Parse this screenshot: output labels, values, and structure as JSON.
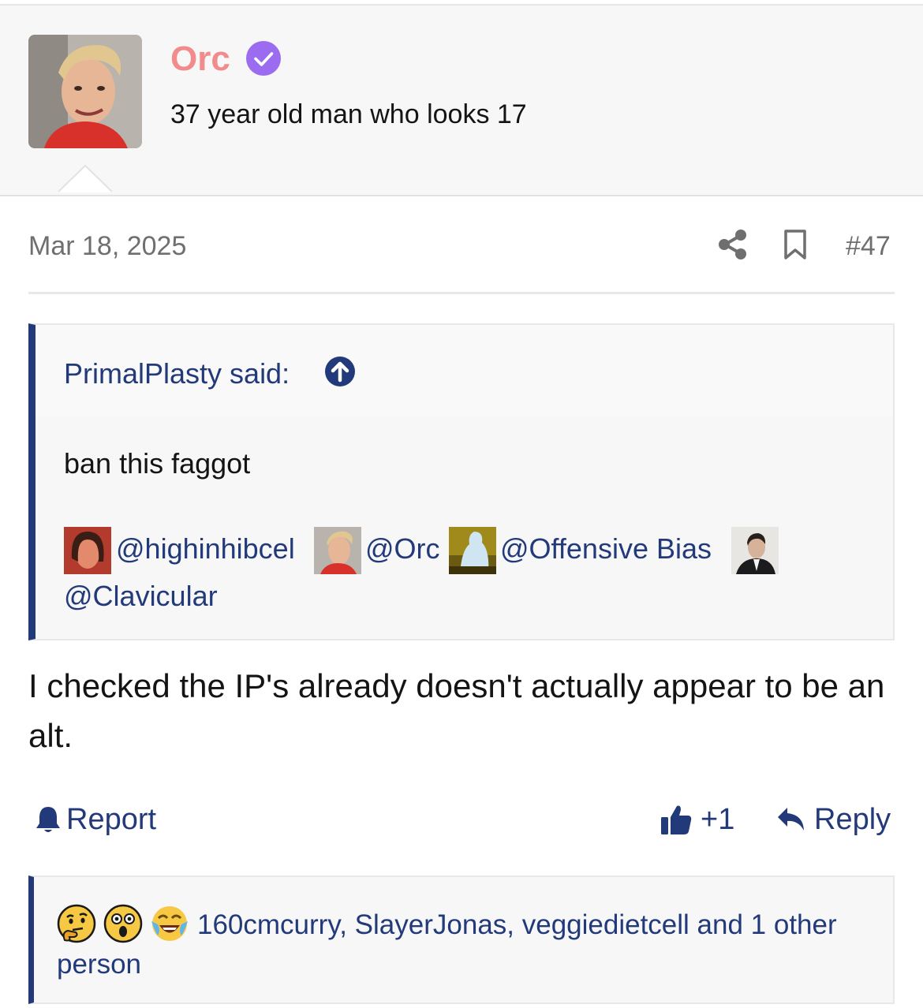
{
  "author": {
    "name": "Orc",
    "title": "37 year old man who looks 17",
    "avatar": "author-photo",
    "verified_icon": "verified-check-icon",
    "name_color": "#f28b8b",
    "verified_color": "#9b6cf0"
  },
  "post": {
    "date": "Mar 18, 2025",
    "number": "#47",
    "share_icon": "share-icon",
    "bookmark_icon": "bookmark-icon",
    "body": "I checked the IP's already doesn't actually appear to be an alt."
  },
  "quote": {
    "attribution": "PrimalPlasty said:",
    "goto_icon": "arrow-up-circle-icon",
    "text": "ban this faggot",
    "mentions": [
      {
        "handle": "@highinhibcel",
        "avatar": "highinhibcel-avatar"
      },
      {
        "handle": "@Orc",
        "avatar": "orc-avatar"
      },
      {
        "handle": "@Offensive Bias",
        "avatar": "offensive-bias-avatar"
      },
      {
        "handle": "@Clavicular",
        "avatar": "clavicular-avatar"
      }
    ]
  },
  "actions": {
    "report": "Report",
    "report_icon": "bell-icon",
    "like_icon": "thumbs-up-icon",
    "like_count": "+1",
    "reply": "Reply",
    "reply_icon": "reply-arrow-icon"
  },
  "reactions": {
    "emojis": [
      "thinking-emoji",
      "astonished-emoji",
      "tears-of-joy-emoji"
    ],
    "text": "160cmcurry, SlayerJonas, veggiedietcell and 1 other person"
  },
  "colors": {
    "link": "#233a7a",
    "muted": "#6f6f6f",
    "panel": "#f7f7f7"
  }
}
